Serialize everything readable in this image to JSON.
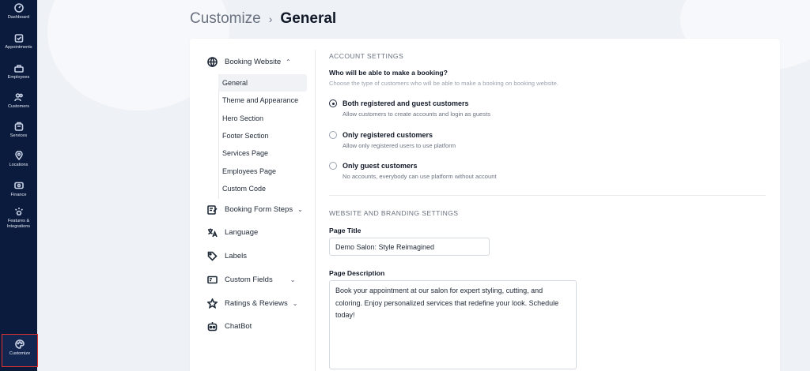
{
  "nav": {
    "items": [
      {
        "label": "Dashboard",
        "icon": "dashboard-icon"
      },
      {
        "label": "Appointments",
        "icon": "calendar-check-icon"
      },
      {
        "label": "Employees",
        "icon": "employees-icon"
      },
      {
        "label": "Customers",
        "icon": "customers-icon"
      },
      {
        "label": "Services",
        "icon": "services-icon"
      },
      {
        "label": "Locations",
        "icon": "location-pin-icon"
      },
      {
        "label": "Finance",
        "icon": "finance-icon"
      },
      {
        "label": "Features & Integrations",
        "icon": "sparkle-icon"
      },
      {
        "label": "Customize",
        "icon": "palette-icon",
        "active": true
      }
    ]
  },
  "breadcrumb": {
    "parent": "Customize",
    "separator": "›",
    "current": "General"
  },
  "menu": {
    "booking_website": {
      "label": "Booking Website",
      "icon": "globe-icon",
      "chevron": "⌃"
    },
    "sub_items": [
      {
        "label": "General",
        "active": true
      },
      {
        "label": "Theme and Appearance"
      },
      {
        "label": "Hero Section"
      },
      {
        "label": "Footer Section"
      },
      {
        "label": "Services Page"
      },
      {
        "label": "Employees Page"
      },
      {
        "label": "Custom Code"
      }
    ],
    "booking_form_steps": {
      "label": "Booking Form Steps",
      "icon": "form-edit-icon",
      "chevron": "⌄"
    },
    "language": {
      "label": "Language",
      "icon": "translate-icon"
    },
    "labels": {
      "label": "Labels",
      "icon": "tag-icon"
    },
    "custom_fields": {
      "label": "Custom Fields",
      "icon": "custom-fields-icon",
      "chevron": "⌄"
    },
    "ratings": {
      "label": "Ratings & Reviews",
      "icon": "star-icon",
      "chevron": "⌄"
    },
    "chatbot": {
      "label": "ChatBot",
      "icon": "chatbot-icon"
    }
  },
  "account": {
    "section_title": "ACCOUNT SETTINGS",
    "question": "Who will be able to make a booking?",
    "question_sub": "Choose the type of customers who will be able to make a booking on booking website.",
    "options": [
      {
        "title": "Both registered and guest customers",
        "desc": "Allow customers to create accounts and login as guests",
        "selected": true
      },
      {
        "title": "Only registered customers",
        "desc": "Allow only registered users to use platform",
        "selected": false
      },
      {
        "title": "Only guest customers",
        "desc": "No accounts, everybody can use platform without account",
        "selected": false
      }
    ]
  },
  "branding": {
    "section_title": "WEBSITE AND BRANDING SETTINGS",
    "page_title_label": "Page Title",
    "page_title_value": "Demo Salon: Style Reimagined",
    "page_desc_label": "Page Description",
    "page_desc_value": "Book your appointment at our salon for expert styling, cutting, and coloring. Enjoy personalized services that redefine your look. Schedule today!"
  },
  "colors": {
    "nav_bg": "#0b1b3d",
    "active_outline": "#e03131",
    "background": "#eef1f6"
  }
}
